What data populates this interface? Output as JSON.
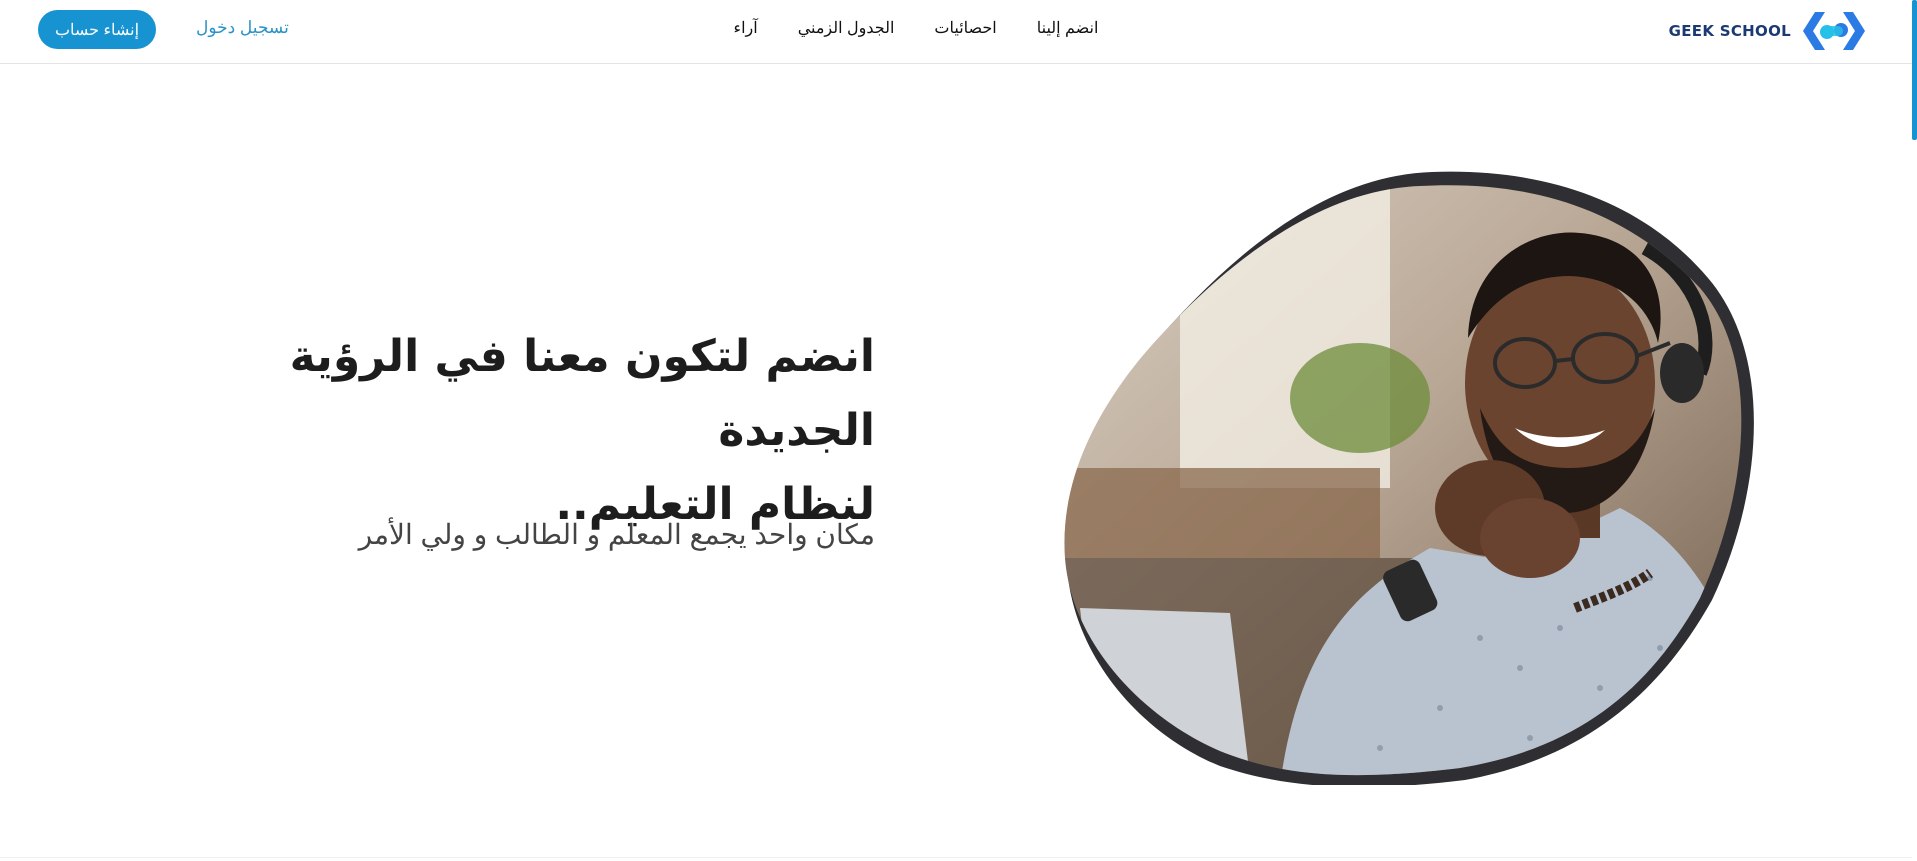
{
  "brand": {
    "name": "GEEK SCHOOL",
    "color": "#1b3a73",
    "logo_colors": [
      "#2c7be5",
      "#27c0e8"
    ]
  },
  "nav": {
    "items": [
      {
        "label": "انضم إلينا",
        "id": "join"
      },
      {
        "label": "احصائيات",
        "id": "stats"
      },
      {
        "label": "الجدول الزمني",
        "id": "schedule"
      },
      {
        "label": "آراء",
        "id": "reviews"
      }
    ],
    "login_label": "تسجيل دخول",
    "signup_label": "إنشاء حساب"
  },
  "hero": {
    "title_line1": "انضم لتكون معنا في الرؤية الجديدة",
    "title_line2": "لنظام التعليم..",
    "subtitle": "مكان واحد يجمع المعلم و الطالب و ولي الأمر",
    "image_icon": "smiling-man-with-headset-photo"
  },
  "colors": {
    "accent": "#1793d1",
    "link": "#2a93c6",
    "text": "#1d1d1d"
  }
}
